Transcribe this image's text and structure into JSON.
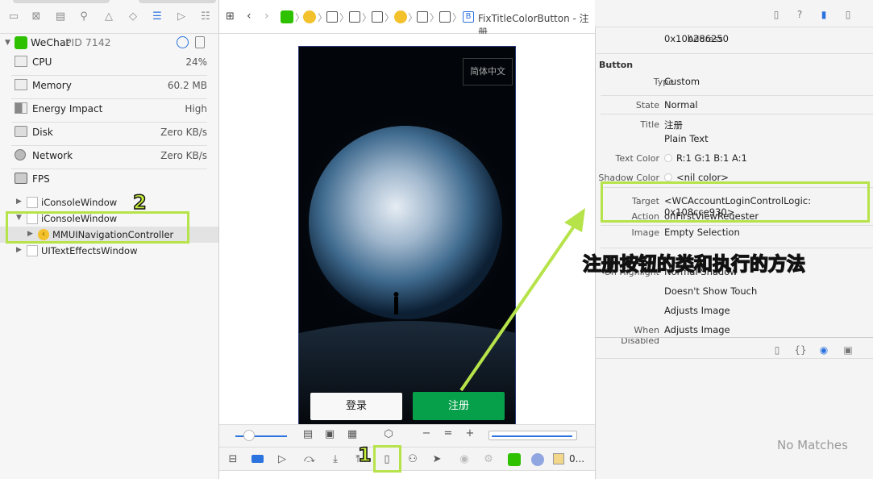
{
  "process": {
    "name": "WeChat",
    "pid": "PID 7142"
  },
  "gauges": [
    {
      "name": "CPU",
      "value": "24%",
      "icon": "cpu-gauge-icon"
    },
    {
      "name": "Memory",
      "value": "60.2 MB",
      "icon": "memory-gauge-icon"
    },
    {
      "name": "Energy Impact",
      "value": "High",
      "icon": "energy-gauge-icon"
    },
    {
      "name": "Disk",
      "value": "Zero KB/s",
      "icon": "disk-icon"
    },
    {
      "name": "Network",
      "value": "Zero KB/s",
      "icon": "network-icon"
    },
    {
      "name": "FPS",
      "value": "",
      "icon": "fps-icon"
    }
  ],
  "tree": [
    {
      "label": "iConsoleWindow",
      "expanded": false
    },
    {
      "label": "iConsoleWindow",
      "expanded": true
    },
    {
      "label": "MMUINavigationController",
      "expanded": false
    },
    {
      "label": "UITextEffectsWindow",
      "expanded": false
    }
  ],
  "jumpbar": {
    "last": "FixTitleColorButton - 注册"
  },
  "phone": {
    "language_button": "简体中文",
    "login_button": "登录",
    "register_button": "注册"
  },
  "debug": {
    "frame_label": "0..."
  },
  "inspector": {
    "address_label": "Address",
    "address_value": "0x10b286250",
    "section": "Button",
    "rows": [
      {
        "label": "Type",
        "value": "Custom"
      },
      {
        "label": "State",
        "value": "Normal"
      },
      {
        "label": "Title",
        "value": "注册"
      },
      {
        "label": "",
        "value": "Plain Text"
      },
      {
        "label": "Text Color",
        "value": "R:1 G:1 B:1 A:1"
      },
      {
        "label": "Shadow Color",
        "value": "<nil color>"
      },
      {
        "label": "Target",
        "value": "<WCAccountLoginControlLogic: 0x108cce930>"
      },
      {
        "label": "Action",
        "value": "onFirstViewRegester"
      },
      {
        "label": "Image",
        "value": "Empty Selection"
      },
      {
        "label": "On Highlight",
        "value": "Normal Shadow"
      },
      {
        "label": "",
        "value": "Doesn't Show Touch"
      },
      {
        "label": "",
        "value": "Adjusts Image"
      },
      {
        "label": "When Disabled",
        "value": "Adjusts Image"
      }
    ],
    "no_matches": "No Matches"
  },
  "annotations": {
    "one": "1",
    "two": "2",
    "callout": "注册按钮的类和执行的方法"
  },
  "colors": {
    "accent": "#2b73de",
    "highlight": "#b7e34a",
    "register_green": "#07a04a"
  }
}
